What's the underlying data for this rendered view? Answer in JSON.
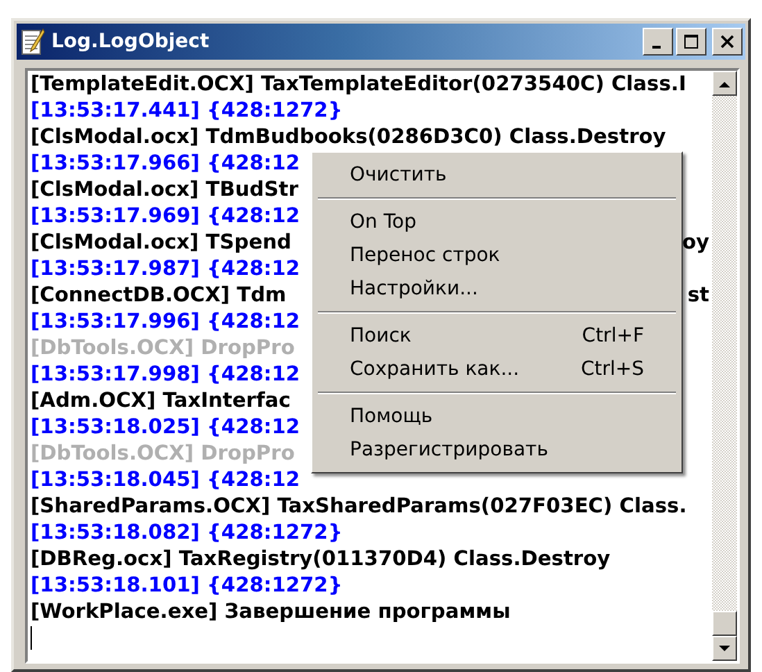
{
  "window": {
    "title": "Log.LogObject"
  },
  "log": [
    {
      "kind": "source",
      "text": "[TemplateEdit.OCX] TaxTemplateEditor(0273540C) Class.I"
    },
    {
      "kind": "time",
      "text": "[13:53:17.441] {428:1272}"
    },
    {
      "kind": "source",
      "text": "[ClsModal.ocx] TdmBudbooks(0286D3C0) Class.Destroy"
    },
    {
      "kind": "time",
      "text": "[13:53:17.966] {428:12"
    },
    {
      "kind": "source",
      "text": "[ClsModal.ocx] TBudStr"
    },
    {
      "kind": "time",
      "text": "[13:53:17.969] {428:12"
    },
    {
      "kind": "source",
      "text": "[ClsModal.ocx] TSpend",
      "tail": "oy"
    },
    {
      "kind": "time",
      "text": "[13:53:17.987] {428:12"
    },
    {
      "kind": "source",
      "text": "[ConnectDB.OCX] Tdm",
      "tail": "st"
    },
    {
      "kind": "time",
      "text": "[13:53:17.996] {428:12"
    },
    {
      "kind": "muted",
      "text": "[DbTools.OCX] DropPro"
    },
    {
      "kind": "time",
      "text": "[13:53:17.998] {428:12"
    },
    {
      "kind": "source",
      "text": "[Adm.OCX] TaxInterfac"
    },
    {
      "kind": "time",
      "text": "[13:53:18.025] {428:12"
    },
    {
      "kind": "muted",
      "text": "[DbTools.OCX] DropPro"
    },
    {
      "kind": "time",
      "text": "[13:53:18.045] {428:12"
    },
    {
      "kind": "source",
      "text": "[SharedParams.OCX] TaxSharedParams(027F03EC) Class."
    },
    {
      "kind": "time",
      "text": "[13:53:18.082] {428:1272}"
    },
    {
      "kind": "source",
      "text": "[DBReg.ocx] TaxRegistry(011370D4) Class.Destroy"
    },
    {
      "kind": "time",
      "text": "[13:53:18.101] {428:1272}"
    },
    {
      "kind": "source",
      "text": "[WorkPlace.exe] Завершение программы"
    }
  ],
  "context_menu": [
    {
      "kind": "item",
      "label": "Очистить"
    },
    {
      "kind": "separator"
    },
    {
      "kind": "item",
      "label": "On Top"
    },
    {
      "kind": "item",
      "label": "Перенос строк"
    },
    {
      "kind": "item",
      "label": "Настройки..."
    },
    {
      "kind": "separator"
    },
    {
      "kind": "item",
      "label": "Поиск",
      "shortcut": "Ctrl+F"
    },
    {
      "kind": "item",
      "label": "Сохранить как...",
      "shortcut": "Ctrl+S"
    },
    {
      "kind": "separator"
    },
    {
      "kind": "item",
      "label": "Помощь"
    },
    {
      "kind": "item",
      "label": "Разрегистрировать"
    }
  ]
}
